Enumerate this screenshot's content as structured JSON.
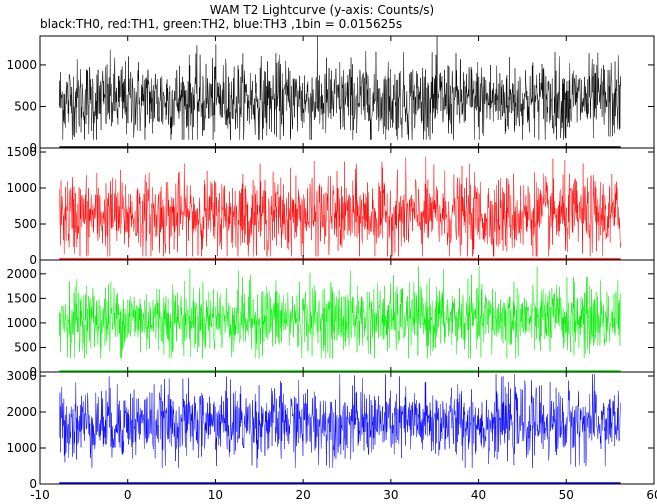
{
  "title": "WAM T2 Lightcurve (y-axis: Counts/s)",
  "subtitle": "black:TH0, red:TH1, green:TH2, blue:TH3 ,1bin = 0.015625s",
  "chart_data": {
    "type": "line",
    "title": "WAM T2 Lightcurve (y-axis: Counts/s)",
    "subtitle": "black:TH0, red:TH1, green:TH2, blue:TH3 ,1bin = 0.015625s",
    "xlabel": "",
    "ylabel": "Counts/s",
    "bin_size_s": 0.015625,
    "xlim": [
      -10,
      60
    ],
    "x_ticks": [
      -10,
      0,
      10,
      20,
      30,
      40,
      50,
      60
    ],
    "x_range": [
      -7.8,
      56.2
    ],
    "grid": false,
    "series": [
      {
        "name": "TH0",
        "color": "#000000",
        "mean": 580,
        "min": 100,
        "max": 1350,
        "ylim": [
          0,
          1300
        ],
        "y_ticks": [
          0,
          500,
          1000
        ]
      },
      {
        "name": "TH1",
        "color": "#ff0000",
        "mean": 620,
        "min": 50,
        "max": 1480,
        "ylim": [
          0,
          1500
        ],
        "y_ticks": [
          0,
          500,
          1000,
          1500
        ]
      },
      {
        "name": "TH2",
        "color": "#00ee00",
        "mean": 1080,
        "min": 280,
        "max": 2150,
        "ylim": [
          0,
          2200
        ],
        "y_ticks": [
          0,
          500,
          1000,
          1500,
          2000
        ]
      },
      {
        "name": "TH3",
        "color": "#0000ff",
        "mean": 1700,
        "min": 450,
        "max": 3050,
        "ylim": [
          0,
          3000
        ],
        "y_ticks": [
          0,
          1000,
          2000,
          3000
        ]
      }
    ]
  }
}
